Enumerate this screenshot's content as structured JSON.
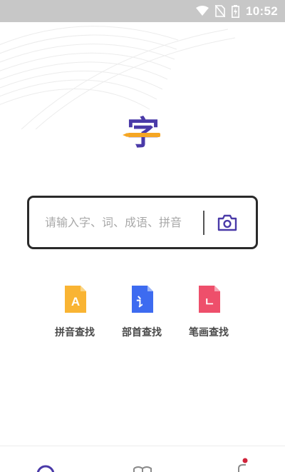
{
  "status_bar": {
    "time": "10:52",
    "icons": [
      "wifi-icon",
      "no-sim-icon",
      "battery-charging-icon"
    ]
  },
  "app": {
    "logo_char": "字"
  },
  "search": {
    "placeholder": "请输入字、词、成语、拼音",
    "value": "",
    "camera_icon": "camera-icon"
  },
  "lookups": [
    {
      "label": "拼音查找",
      "icon_text": "A",
      "icon": "pinyin-icon",
      "color": "#f9b433"
    },
    {
      "label": "部首查找",
      "icon_text": "讠",
      "icon": "radical-icon",
      "color": "#3d6bf0"
    },
    {
      "label": "笔画查找",
      "icon_text": "ㄴ",
      "icon": "stroke-icon",
      "color": "#ee4f6b"
    }
  ],
  "bottom_nav": {
    "items": [
      {
        "icon": "search-icon"
      },
      {
        "icon": "book-icon"
      },
      {
        "icon": "profile-icon",
        "badge_color": "#d0243b"
      }
    ]
  },
  "colors": {
    "brand_purple": "#4a3aa8",
    "brand_orange": "#f5a623",
    "status_bar_bg": "#c7c7c7"
  }
}
